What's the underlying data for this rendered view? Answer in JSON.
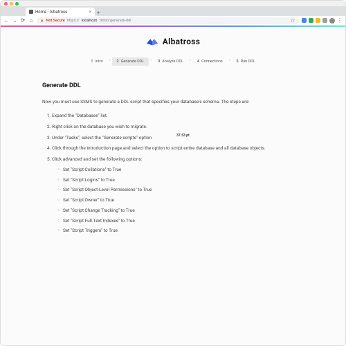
{
  "browser": {
    "tab_title": "Home · Albatross",
    "url_not_secure": "Not Secure",
    "url_scheme": "https://",
    "url_host": "localhost",
    "url_path": ":9000/generate-ddl",
    "nav": {
      "back": "←",
      "fwd": "→",
      "reload": "⟳",
      "home": "⌂",
      "menu": "⋮",
      "star": "☆"
    }
  },
  "brand": "Albatross",
  "badge_text": "37.53 pt",
  "steps": [
    {
      "n": "1",
      "label": "Intro"
    },
    {
      "n": "2",
      "label": "Generate DDL"
    },
    {
      "n": "3",
      "label": "Analyze DDL"
    },
    {
      "n": "4",
      "label": "Connections"
    },
    {
      "n": "5",
      "label": "Run DDL"
    }
  ],
  "heading": "Generate DDL",
  "intro_text": "Now you must use SSMS to generate a DDL script that specifies your database's schema. The steps are:",
  "ol": [
    "Expand the \"Databases\" list.",
    "Right click on the database you wish to migrate.",
    "Under \"Tasks\", select the \"Generate scripts\" option",
    "Click through the introduction page and select the option to script entire database and all database objects.",
    "Click advanced and set the following options:"
  ],
  "ul": [
    "Set \"Script Collations\" to True",
    "Set \"Script Logins\" to True",
    "Set \"Script Object-Level Permissions\" to True",
    "Set \"Script Owner\" to True",
    "Set \"Script Change Tracking\" to True",
    "Set \"Script Full-Text Indexes\" to True",
    "Set \"Script Triggers\" to True"
  ]
}
